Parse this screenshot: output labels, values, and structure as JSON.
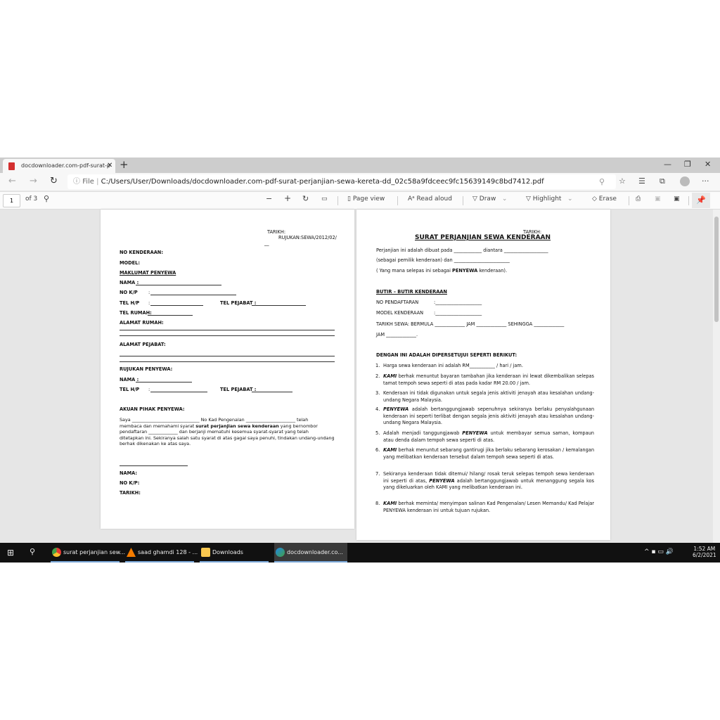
{
  "browser": {
    "tab_title": "docdownloader.com-pdf-surat-p",
    "url_prefix": "File",
    "url": "C:/Users/User/Downloads/docdownloader.com-pdf-surat-perjanjian-sewa-kereta-dd_02c58a9fdceec9fc15639149c8bd7412.pdf"
  },
  "pdf_toolbar": {
    "page": "1",
    "of": "of 3",
    "page_view": "Page view",
    "read_aloud": "Read aloud",
    "draw": "Draw",
    "highlight": "Highlight",
    "erase": "Erase"
  },
  "page1": {
    "tarikh": "TARIKH:",
    "rujukan": "RUJUKAN:SEWA/2012/02/",
    "rujukan2": "__",
    "no_kenderaan": "NO KENDERAAN:",
    "model": "MODEL:",
    "maklumat": "MAKLUMAT PENYEWA",
    "nama": "NAMA :",
    "nokp": "NO K/P",
    "colon": ":",
    "telhp": "TEL H/P",
    "telpejabat": "TEL PEJABAT :",
    "telrumah": "TEL RUMAH:",
    "alamat_rumah": "ALAMAT RUMAH:",
    "alamat_pejabat": "ALAMAT PEJABAT:",
    "rujukan_penyewa": "RUJUKAN PENYEWA:",
    "akuan": "AKUAN PIHAK PENYEWA:",
    "para_1": "Saya ______________________________ No Kad Pengenalan ______________________ telah",
    "para_2a": "membaca dan memahami syarat ",
    "para_2b": "surat perjanjian sewa kenderaan",
    "para_2c": " yang bernombor",
    "para_3": "pendaftaran _____________ dan berjanji mematuhi kesemua syarat-syarat yang telah",
    "para_4": "ditetapkan ini. Sekiranya salah satu syarat di atas gagal saya penuhi, tindakan undang-undang",
    "para_5": "berhak dikenakan ke atas saya.",
    "sig_nama": "NAMA:",
    "sig_nokp": "NO K/P:",
    "sig_tarikh": "TARIKH:"
  },
  "page2": {
    "tarikh": "TARIKH:",
    "title": "SURAT PERJANJIAN SEWA KENDERAAN",
    "l1": "Perjanjian ini adalah dibuat pada ____________   diantara ___________________",
    "l2": "(sebagai pemilik kenderaan) dan ________________________",
    "l3a": "( Yang mana selepas ini sebagai ",
    "l3b": "PENYEWA",
    "l3c": " kenderaan).",
    "butir": "BUTIR – BUTIR KENDERAAN",
    "nopendaftaran": "NO PENDAFTARAN",
    "modelk": "MODEL KENDERAAN",
    "fill": ":____________________",
    "tarikh_sewa": "TARIKH SEWA: BERMULA _____________ JAM _____________ SEHINGGA _____________",
    "jam": "JAM _____________.",
    "dengan": "DENGAN INI ADALAH DIPERSETUJUI SEPERTI BERIKUT:",
    "items": [
      {
        "n": "1.",
        "pre": "",
        "b": "",
        "t": "Harga sewa kenderaan ini adalah RM___________ / hari / jam."
      },
      {
        "n": "2.",
        "pre": "",
        "b": "KAMI",
        "t": "  berhak menuntut bayaran tambahan jika kenderaan ini lewat dikembalikan selepas tamat tempoh sewa seperti di atas pada kadar RM 20.00 / jam."
      },
      {
        "n": "3.",
        "pre": "",
        "b": "",
        "t": "Kenderaan ini tidak digunakan untuk segala jenis aktiviti jenayah atau kesalahan undang-undang Negara Malaysia."
      },
      {
        "n": "4.",
        "pre": "",
        "b": "PENYEWA",
        "t": " adalah bertanggungjawab sepenuhnya sekiranya berlaku penyalahgunaan kenderaan ini seperti terlibat dengan segala jenis aktiviti jenayah atau kesalahan undang-undang Negara Malaysia."
      },
      {
        "n": "5.",
        "pre": "Adalah menjadi tanggungjawab ",
        "b": "PENYEWA",
        "t": " untuk membayar semua saman, kompaun atau denda dalam tempoh sewa seperti di atas."
      },
      {
        "n": "6.",
        "pre": "",
        "b": "KAMI",
        "t": " berhak menuntut sebarang gantirugi jika berlaku sebarang kerosakan / kemalangan yang melibatkan kenderaan tersebut dalam tempoh sewa seperti di atas."
      },
      {
        "n": "7.",
        "pre": "Sekiranya kenderaan tidak ditemui/ hilang/ rosak teruk selepas tempoh sewa kenderaan ini seperti di atas, ",
        "b": "PENYEWA",
        "t": " adalah bertanggungjawab untuk menanggung segala kos yang dikeluarkan oleh KAMI  yang melibatkan kenderaan ini."
      },
      {
        "n": "8.",
        "pre": "",
        "b": "KAMI",
        "t": "   berhak meminta/ menyimpan salinan Kad Pengenalan/ Lesen Memandu/ Kad Pelajar PENYEWA kenderaan ini untuk tujuan rujukan."
      }
    ]
  },
  "taskbar": {
    "items": [
      "surat perjanjian sew...",
      "saad ghamdi 128 - ...",
      "Downloads",
      "docdownloader.co..."
    ],
    "time": "1:52 AM",
    "date": "6/2/2021"
  }
}
